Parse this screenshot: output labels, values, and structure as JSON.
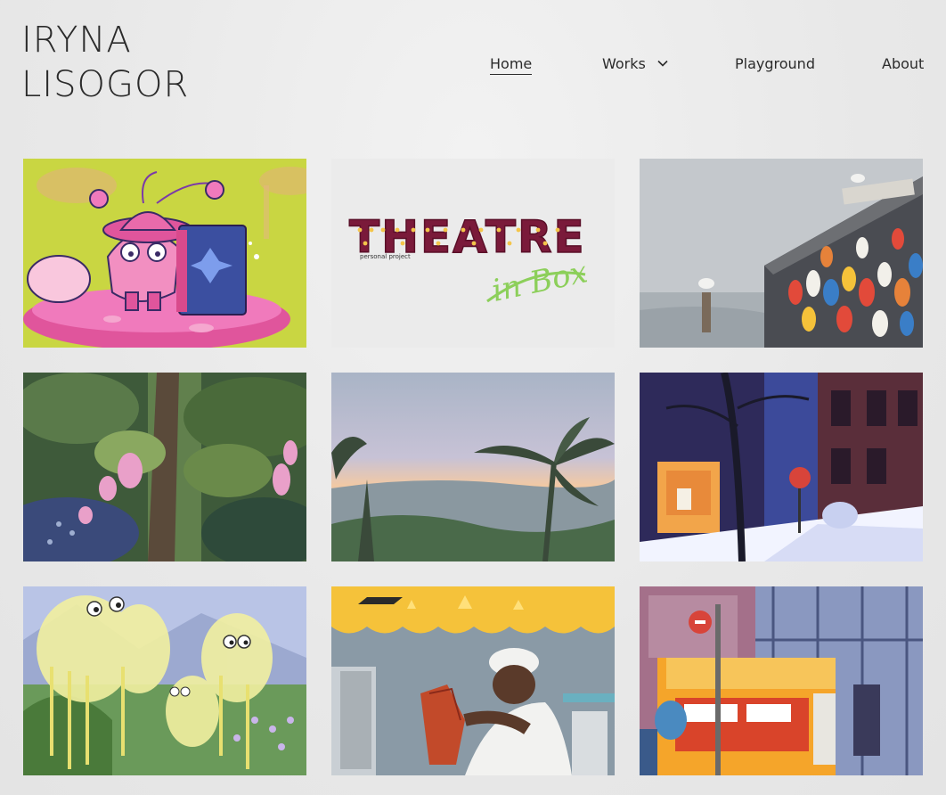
{
  "site": {
    "name_line1": "IRYNA",
    "name_line2": "LISOGOR"
  },
  "nav": {
    "home": "Home",
    "works": "Works",
    "playground": "Playground",
    "about": "About",
    "active": "Home"
  },
  "gallery": {
    "tiles": [
      {
        "subject": "pink beetle character with book on mushroom",
        "bg_color": "#c9d642"
      },
      {
        "subject": "Theatre in a Box logo",
        "title": "THEATRE",
        "script": "in Box",
        "caption": "personal project",
        "title_color": "#7a1a3a",
        "script_color": "#8ccf5a"
      },
      {
        "subject": "fishing shack with buoys and seagulls",
        "bg_color": "#c4c8cc"
      },
      {
        "subject": "lush jungle with pink flowers",
        "bg_color": "#3e5a3a"
      },
      {
        "subject": "sunset over banana palms",
        "bg_color": "#a9b4c6"
      },
      {
        "subject": "snowy street at night with storefront",
        "bg_color": "#3c4a9a"
      },
      {
        "subject": "fluffy yellow creatures in a meadow",
        "bg_color": "#e8e89a"
      },
      {
        "subject": "al pastor taco stand with vendor",
        "bg_color": "#f0a82a"
      },
      {
        "subject": "Japanese street kiosk with stop sign",
        "bg_color": "#6c7aa6"
      }
    ]
  }
}
